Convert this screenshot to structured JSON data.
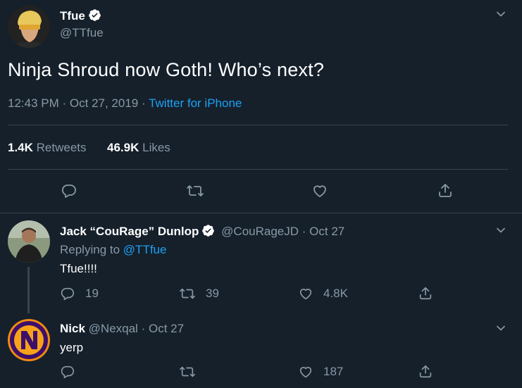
{
  "main_tweet": {
    "author_name": "Tfue",
    "author_handle": "@TTfue",
    "text": "Ninja Shroud now Goth! Who’s next?",
    "time": "12:43 PM",
    "separator": "·",
    "date": "Oct 27, 2019",
    "source": "Twitter for iPhone",
    "retweets_count": "1.4K",
    "retweets_label": "Retweets",
    "likes_count": "46.9K",
    "likes_label": "Likes"
  },
  "replies": [
    {
      "author_name": "Jack “CouRage” Dunlop",
      "author_handle": "@CouRageJD",
      "separator": "·",
      "date": "Oct 27",
      "replying_prefix": "Replying to",
      "replying_handle": "@TTfue",
      "text": "Tfue!!!!",
      "reply_count": "19",
      "retweet_count": "39",
      "like_count": "4.8K"
    },
    {
      "author_name": "Nick",
      "author_handle": "@Nexqal",
      "separator": "·",
      "date": "Oct 27",
      "text": "yerp",
      "like_count": "187"
    }
  ],
  "colors": {
    "background": "#15202b",
    "accent": "#1da1f2",
    "muted": "#8899a6",
    "divider": "#38444d"
  },
  "icons": [
    "verified-badge-icon",
    "chevron-down-icon",
    "reply-icon",
    "retweet-icon",
    "like-icon",
    "share-icon"
  ]
}
